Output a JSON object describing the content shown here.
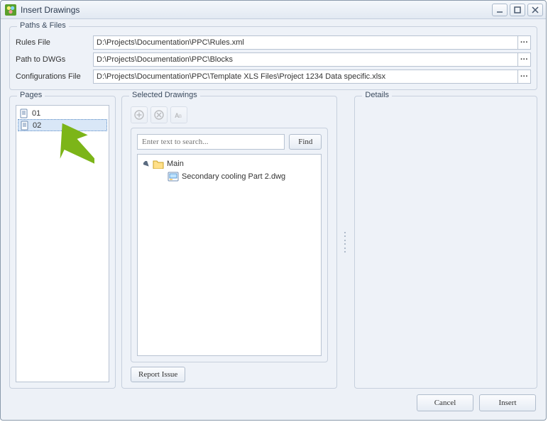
{
  "window": {
    "title": "Insert Drawings"
  },
  "paths": {
    "legend": "Paths & Files",
    "rules_label": "Rules File",
    "rules_value": "D:\\Projects\\Documentation\\PPC\\Rules.xml",
    "dwg_label": "Path to DWGs",
    "dwg_value": "D:\\Projects\\Documentation\\PPC\\Blocks",
    "config_label": "Configurations File",
    "config_value": "D:\\Projects\\Documentation\\PPC\\Template XLS Files\\Project 1234 Data specific.xlsx"
  },
  "pages": {
    "legend": "Pages",
    "items": [
      {
        "label": "01",
        "selected": false
      },
      {
        "label": "02",
        "selected": true
      }
    ]
  },
  "selected": {
    "legend": "Selected Drawings",
    "search_placeholder": "Enter text to search...",
    "find_label": "Find",
    "tree_root": "Main",
    "tree_child": "Secondary cooling Part 2.dwg",
    "report_label": "Report Issue"
  },
  "details": {
    "legend": "Details"
  },
  "footer": {
    "cancel": "Cancel",
    "insert": "Insert"
  }
}
